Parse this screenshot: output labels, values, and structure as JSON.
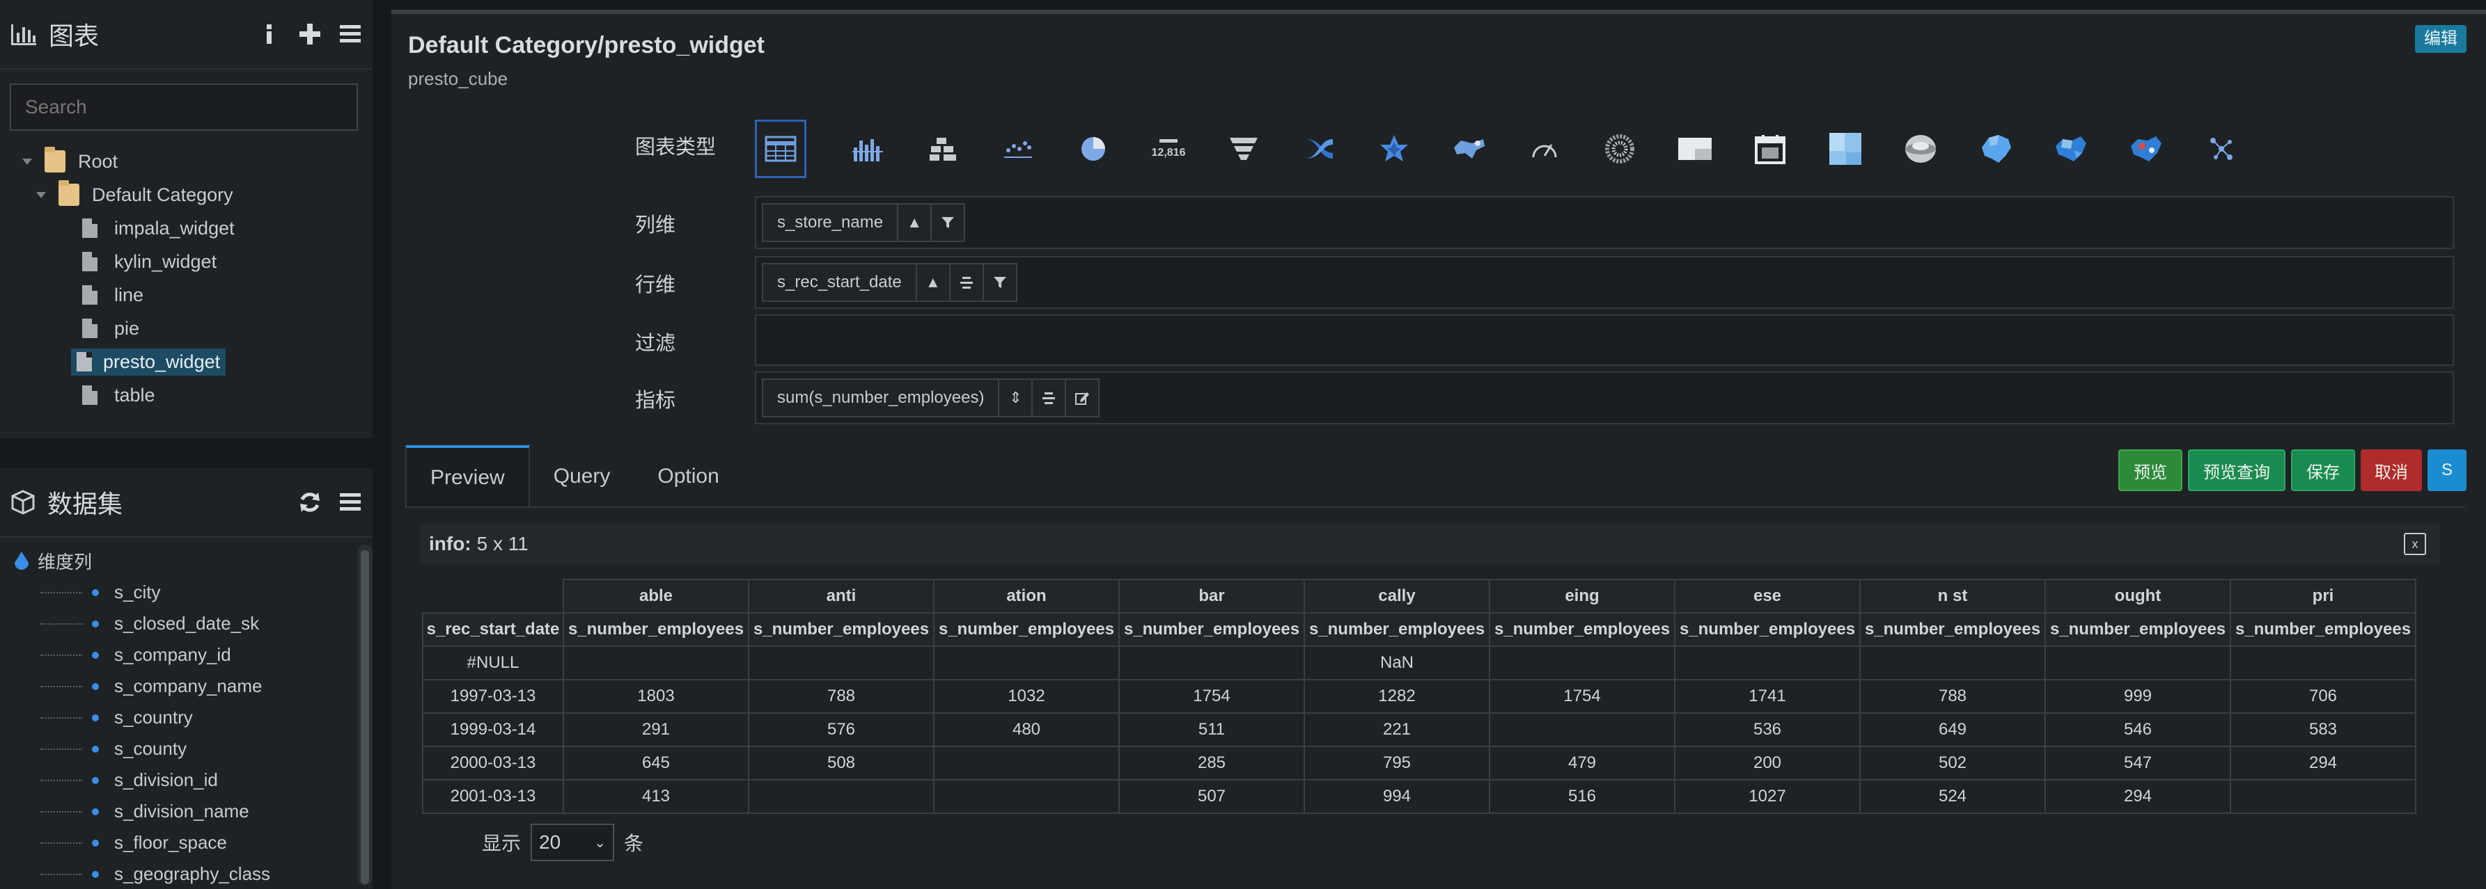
{
  "sidebar": {
    "charts_title": "图表",
    "search_placeholder": "Search",
    "tree": {
      "root": "Root",
      "category": "Default Category",
      "items": [
        "impala_widget",
        "kylin_widget",
        "line",
        "pie",
        "presto_widget",
        "table"
      ],
      "selected": "presto_widget"
    },
    "dataset_title": "数据集",
    "dim_root": "维度列",
    "dims": [
      "s_city",
      "s_closed_date_sk",
      "s_company_id",
      "s_company_name",
      "s_country",
      "s_county",
      "s_division_id",
      "s_division_name",
      "s_floor_space",
      "s_geography_class"
    ]
  },
  "header": {
    "title": "Default Category/presto_widget",
    "subtitle": "presto_cube",
    "edit_label": "编辑"
  },
  "fields": {
    "chart_type_label": "图表类型",
    "columns_label": "列维",
    "columns_chip": "s_store_name",
    "rows_label": "行维",
    "rows_chip": "s_rec_start_date",
    "filter_label": "过滤",
    "metrics_label": "指标",
    "metrics_chip": "sum(s_number_employees)"
  },
  "chart_types": [
    "table-icon",
    "bar-icon",
    "stacked-bar-icon",
    "scatter-icon",
    "pie-icon",
    "number-icon",
    "funnel-icon",
    "sankey-icon",
    "radar-icon",
    "map-icon",
    "gauge-icon",
    "wordcloud-icon",
    "heatmap-icon",
    "calendar-icon",
    "treemap-icon",
    "globe-icon",
    "china-map-icon",
    "world-map-icon",
    "province-map-icon",
    "relation-icon"
  ],
  "number_icon_text": "12,816",
  "tabs": [
    "Preview",
    "Query",
    "Option"
  ],
  "actions": {
    "preview": "预览",
    "preview_query": "预览查询",
    "save": "保存",
    "cancel": "取消",
    "s": "S"
  },
  "info": {
    "label": "info:",
    "value": "5 x 11"
  },
  "table": {
    "stores": [
      "able",
      "anti",
      "ation",
      "bar",
      "cally",
      "eing",
      "ese",
      "n st",
      "ought",
      "pri"
    ],
    "row_header": "s_rec_start_date",
    "metric_header": "s_number_employees",
    "rows": [
      [
        "#NULL",
        "",
        "",
        "",
        "",
        "NaN",
        "",
        "",
        "",
        "",
        ""
      ],
      [
        "1997-03-13",
        "1803",
        "788",
        "1032",
        "1754",
        "1282",
        "1754",
        "1741",
        "788",
        "999",
        "706"
      ],
      [
        "1999-03-14",
        "291",
        "576",
        "480",
        "511",
        "221",
        "",
        "536",
        "649",
        "546",
        "583"
      ],
      [
        "2000-03-13",
        "645",
        "508",
        "",
        "285",
        "795",
        "479",
        "200",
        "502",
        "547",
        "294"
      ],
      [
        "2001-03-13",
        "413",
        "",
        "",
        "507",
        "994",
        "516",
        "1027",
        "524",
        "294",
        ""
      ]
    ]
  },
  "pager": {
    "show_label": "显示",
    "page_size": "20",
    "unit": "条"
  },
  "colors": {
    "accent": "#2a8ee0",
    "selected_bg": "#1d4b63",
    "save_green": "#2c8a3a",
    "cancel_red": "#b02c2a"
  }
}
